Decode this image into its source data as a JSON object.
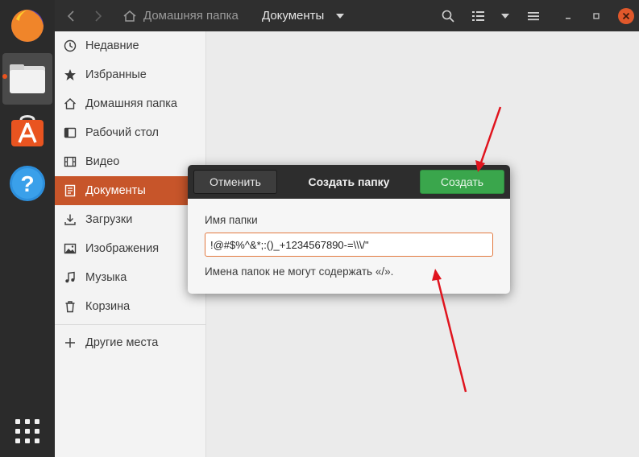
{
  "dock": {
    "apps": [
      {
        "icon": "firefox-icon"
      },
      {
        "icon": "files-icon",
        "active": true
      },
      {
        "icon": "software-center-icon"
      },
      {
        "icon": "help-icon"
      }
    ],
    "show_apps_icon": "app-grid-icon"
  },
  "header": {
    "back_icon": "chevron-left-icon",
    "forward_icon": "chevron-right-icon",
    "home_label": "Домашняя папка",
    "current_label": "Документы",
    "search_icon": "search-icon",
    "view_icon": "list-view-icon",
    "menu_icon": "hamburger-icon"
  },
  "sidebar": {
    "items": [
      {
        "label": "Недавние",
        "icon": "clock-icon"
      },
      {
        "label": "Избранные",
        "icon": "star-icon"
      },
      {
        "label": "Домашняя папка",
        "icon": "home-icon"
      },
      {
        "label": "Рабочий стол",
        "icon": "desktop-icon"
      },
      {
        "label": "Видео",
        "icon": "film-icon"
      },
      {
        "label": "Документы",
        "icon": "document-icon",
        "active": true
      },
      {
        "label": "Загрузки",
        "icon": "download-icon"
      },
      {
        "label": "Изображения",
        "icon": "image-icon"
      },
      {
        "label": "Музыка",
        "icon": "music-icon"
      },
      {
        "label": "Корзина",
        "icon": "trash-icon"
      }
    ],
    "other_places": "Другие места"
  },
  "dialog": {
    "title": "Создать папку",
    "cancel_label": "Отменить",
    "create_label": "Создать",
    "field_label": "Имя папки",
    "field_value": "!@#$%^&*;:()_+1234567890-=\\\\\\/\"",
    "hint": "Имена папок не могут содержать «/»."
  },
  "colors": {
    "accent": "#c7552a",
    "create_button": "#3aa64c",
    "arrow": "#e0141e"
  }
}
